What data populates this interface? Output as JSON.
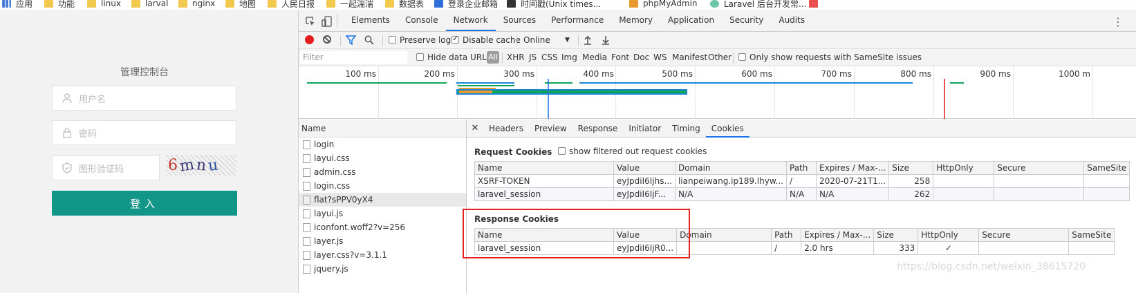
{
  "bookmarks": [
    {
      "label": "应用",
      "icon": "apps-grid-icon"
    },
    {
      "label": "功能",
      "icon": "folder-icon"
    },
    {
      "label": "linux",
      "icon": "folder-icon"
    },
    {
      "label": "larval",
      "icon": "folder-icon"
    },
    {
      "label": "nginx",
      "icon": "folder-icon"
    },
    {
      "label": "地图",
      "icon": "folder-icon"
    },
    {
      "label": "人民日报",
      "icon": "folder-icon"
    },
    {
      "label": "一起湍湍",
      "icon": "folder-icon"
    },
    {
      "label": "数据表",
      "icon": "folder-icon"
    },
    {
      "label": "登录企业邮箱",
      "icon": "mail-icon"
    },
    {
      "label": "时间戳(Unix times...",
      "icon": "clock-icon"
    },
    {
      "label": "phpMyAdmin",
      "icon": "phpmyadmin-icon"
    },
    {
      "label": "Laravel 后台开发常...",
      "icon": "laravel-icon"
    }
  ],
  "login": {
    "title": "管理控制台",
    "username_placeholder": "用户名",
    "password_placeholder": "密码",
    "captcha_placeholder": "图形验证码",
    "captcha_text": [
      "6",
      "m",
      "n",
      "u"
    ],
    "submit_label": "登入",
    "accent_color": "#119688"
  },
  "devtools": {
    "tabs": [
      "Elements",
      "Console",
      "Network",
      "Sources",
      "Performance",
      "Memory",
      "Application",
      "Security",
      "Audits"
    ],
    "active_tab": "Network",
    "toolbar": {
      "preserve_log": "Preserve log",
      "disable_cache": "Disable cache",
      "throttle": "Online"
    },
    "filter": {
      "placeholder": "Filter",
      "hide_data_urls": "Hide data URLs",
      "all": "All",
      "types": [
        "XHR",
        "JS",
        "CSS",
        "Img",
        "Media",
        "Font",
        "Doc",
        "WS",
        "Manifest",
        "Other"
      ],
      "samesite": "Only show requests with SameSite issues"
    },
    "timeline_ticks": [
      "100 ms",
      "200 ms",
      "300 ms",
      "400 ms",
      "500 ms",
      "600 ms",
      "700 ms",
      "800 ms",
      "900 ms",
      "1000 m"
    ],
    "name_header": "Name",
    "requests": [
      "login",
      "layui.css",
      "admin.css",
      "login.css",
      "flat?sPPV0yX4",
      "layui.js",
      "iconfont.woff2?v=256",
      "layer.js",
      "layer.css?v=3.1.1",
      "jquery.js"
    ],
    "selected_request": "flat?sPPV0yX4",
    "detail_tabs": [
      "Headers",
      "Preview",
      "Response",
      "Initiator",
      "Timing",
      "Cookies"
    ],
    "active_detail_tab": "Cookies",
    "request_cookies": {
      "title": "Request Cookies",
      "show_filtered": "show filtered out request cookies",
      "columns": [
        "Name",
        "Value",
        "Domain",
        "Path",
        "Expires / Max-...",
        "Size",
        "HttpOnly",
        "Secure",
        "SameSite"
      ],
      "rows": [
        [
          "XSRF-TOKEN",
          "eyJpdiI6Ijhs...",
          "lianpeiwang.ip189.lhyw...",
          "/",
          "2020-07-21T1...",
          "258",
          "",
          "",
          ""
        ],
        [
          "laravel_session",
          "eyJpdiI6IjF...",
          "N/A",
          "N/A",
          "N/A",
          "262",
          "",
          "",
          ""
        ]
      ]
    },
    "response_cookies": {
      "title": "Response Cookies",
      "columns": [
        "Name",
        "Value",
        "Domain",
        "Path",
        "Expires / Max-...",
        "Size",
        "HttpOnly",
        "Secure",
        "SameSite"
      ],
      "rows": [
        [
          "laravel_session",
          "eyJpdiI6IjR0...",
          "",
          "/",
          "2.0 hrs",
          "333",
          "✓",
          "",
          ""
        ]
      ]
    }
  },
  "watermark": "https://blog.csdn.net/weixin_38615720"
}
